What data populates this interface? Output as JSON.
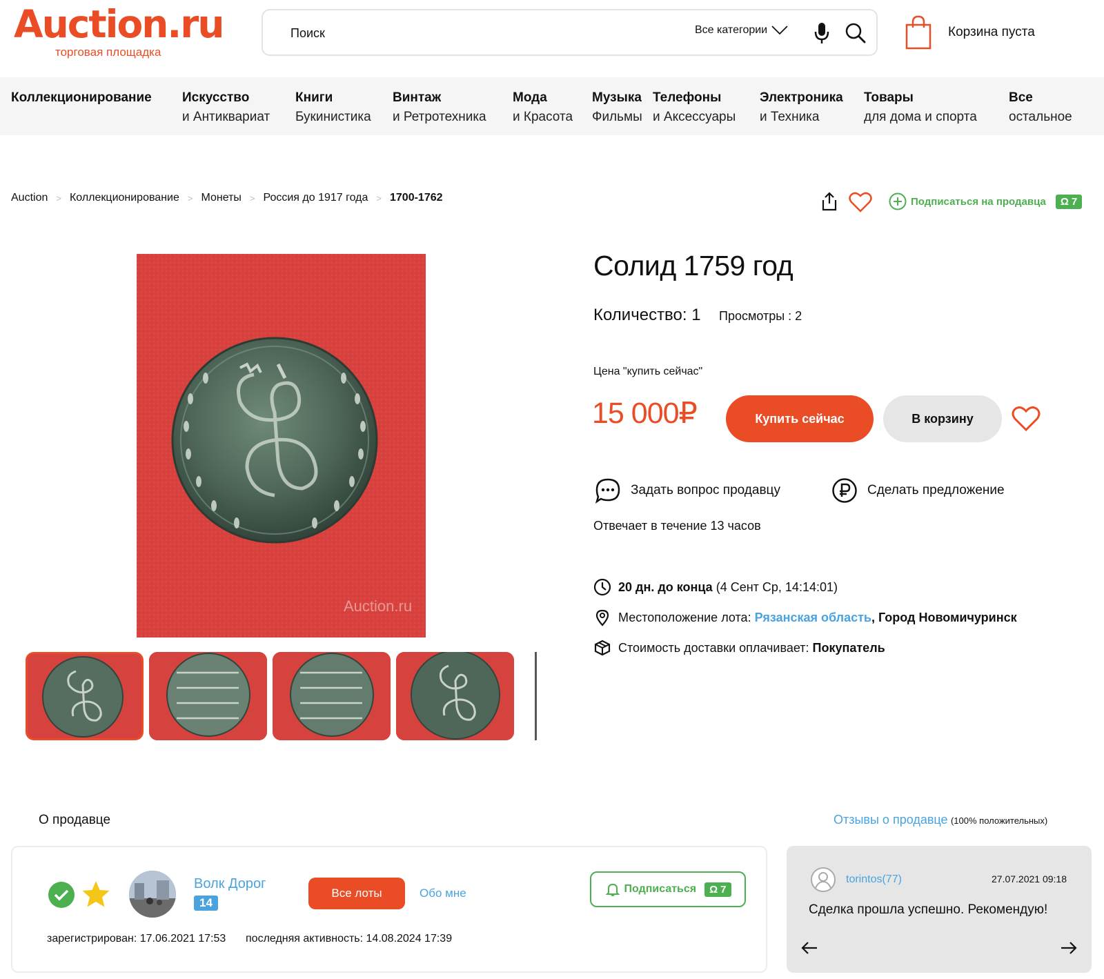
{
  "header": {
    "logo_main": "Auction.ru",
    "logo_sub": "торговая площадка",
    "search_placeholder": "Поиск",
    "search_category": "Все категории",
    "cart_label": "Корзина пуста"
  },
  "categories": [
    {
      "title": "Коллекционирование",
      "sub": ""
    },
    {
      "title": "Искусство",
      "sub": "и Антиквариат"
    },
    {
      "title": "Книги",
      "sub": "Букинистика"
    },
    {
      "title": "Винтаж",
      "sub": "и Ретротехника"
    },
    {
      "title": "Мода",
      "sub": "и Красота"
    },
    {
      "title": "Музыка",
      "sub": "Фильмы"
    },
    {
      "title": "Телефоны",
      "sub": "и Аксессуары"
    },
    {
      "title": "Электроника",
      "sub": "и Техника"
    },
    {
      "title": "Товары",
      "sub": "для дома и спорта"
    },
    {
      "title": "Все",
      "sub": "остальное"
    }
  ],
  "breadcrumbs": [
    "Auction",
    "Коллекционирование",
    "Монеты",
    "Россия до 1917 года",
    "1700-1762"
  ],
  "top_actions": {
    "subscribe_label": "Подписаться на продавца",
    "subscribers_count": "7"
  },
  "product": {
    "title": "Солид 1759 год",
    "quantity": "Количество: 1",
    "views": "Просмотры : 2",
    "price_label": "Цена \"купить сейчас\"",
    "price": "15 000₽",
    "buy_now": "Купить сейчас",
    "add_to_cart": "В корзину",
    "ask_seller": "Задать вопрос продавцу",
    "make_offer": "Сделать предложение",
    "reply_time": "Отвечает в течение 13 часов",
    "time_left_bold": "20 дн. до конца",
    "time_left_rest": "(4 Сент Ср, 14:14:01)",
    "location_label": "Местоположение лота:",
    "location_region": "Рязанская область",
    "location_city": ", Город Новомичуринск",
    "delivery_label": "Стоимость доставки оплачивает:",
    "delivery_payer": "Покупатель",
    "watermark": "Auction.ru"
  },
  "thumbnails": [
    {
      "icon": "coin-obverse",
      "selected": true
    },
    {
      "icon": "coin-reverse-solid-1759",
      "selected": false
    },
    {
      "icon": "coin-reverse-solid-1759",
      "selected": false
    },
    {
      "icon": "coin-obverse",
      "selected": false
    }
  ],
  "seller": {
    "section_title": "О продавце",
    "reviews_link": "Отзывы о продавце",
    "reviews_percent": "(100% положительных)",
    "name": "Волк Дорог",
    "level": "14",
    "all_lots": "Все лоты",
    "about_me": "Обо мне",
    "subscribe": "Подписаться",
    "subscribers_count": "7",
    "registered": "зарегистрирован: 17.06.2021 17:53",
    "last_activity": "последняя активность: 14.08.2024 17:39"
  },
  "review": {
    "user": "torintos(77)",
    "date": "27.07.2021 09:18",
    "text": "Сделка прошла успешно. Рекомендую!"
  },
  "colors": {
    "accent": "#ea4d26",
    "green": "#4caf50",
    "link": "#4aa3df"
  }
}
